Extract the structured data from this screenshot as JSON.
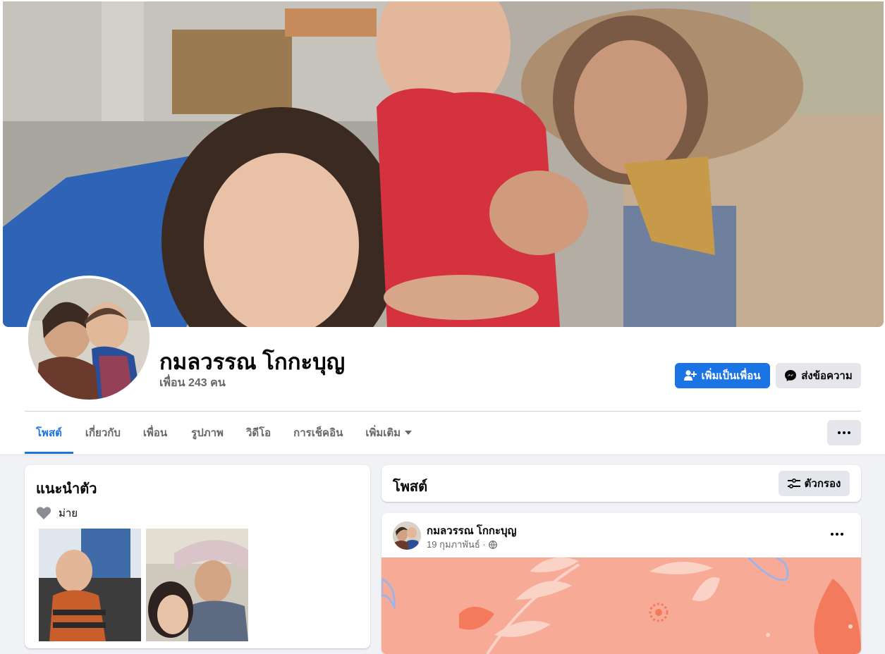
{
  "profile": {
    "name": "กมลวรรณ โกกะบุญ",
    "friends": "เพื่อน 243 คน"
  },
  "actions": {
    "add_friend": "เพิ่มเป็นเพื่อน",
    "message": "ส่งข้อความ"
  },
  "tabs": [
    {
      "label": "โพสต์",
      "active": true
    },
    {
      "label": "เกี่ยวกับ"
    },
    {
      "label": "เพื่อน"
    },
    {
      "label": "รูปภาพ"
    },
    {
      "label": "วิดีโอ"
    },
    {
      "label": "การเช็คอิน"
    },
    {
      "label": "เพิ่มเติม"
    }
  ],
  "intro": {
    "title": "แนะนำตัว",
    "relationship": "ม่าย"
  },
  "posts": {
    "title": "โพสต์",
    "filter": "ตัวกรอง"
  },
  "post": {
    "author": "กมลวรรณ โกกะบุญ",
    "date": "19 กุมภาพันธ์ ·"
  },
  "colors": {
    "primary": "#1b74e4",
    "background": "#f0f2f5",
    "secondary_button": "#e4e6eb",
    "muted_text": "#65676b"
  },
  "icons": [
    "add-friend-icon",
    "messenger-icon",
    "dropdown-arrow-icon",
    "more-dots-icon",
    "heart-icon",
    "filter-icon",
    "globe-icon"
  ]
}
